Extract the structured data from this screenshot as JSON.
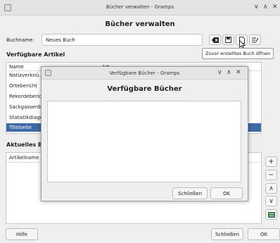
{
  "main_window": {
    "title": "Bücher verwalten - Gramps",
    "heading": "Bücher verwalten",
    "book_name_label": "Buchname:",
    "book_name_value": "Neues Buch",
    "available_items_label": "Verfügbare Artikel",
    "columns": [
      "Name",
      "Art"
    ],
    "available_items": [
      "Notizverknü…",
      "Ortebericht",
      "Rekordeberic…",
      "Sackgassenbe…",
      "Statistikdiagr…",
      "Titelseite"
    ],
    "selected_item": "Titelseite",
    "current_book_label": "Aktuelles Bu…",
    "current_columns": [
      "Artikelname"
    ],
    "help_button": "Hilfe",
    "close_button": "Schließen",
    "ok_button": "OK",
    "tooltip": "Zuvor erstelltes Buch öffnen",
    "colors": {
      "selection": "#3e6aa6",
      "accent_green": "#3a7a4a"
    }
  },
  "dialog": {
    "title": "Verfügbare Bücher - Gramps",
    "heading": "Verfügbare Bücher",
    "close_button": "Schließen",
    "ok_button": "OK"
  }
}
